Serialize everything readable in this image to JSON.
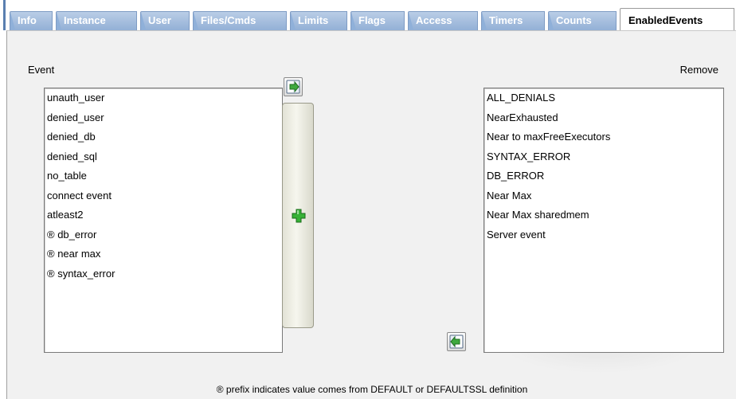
{
  "tabs": [
    {
      "label": "Info",
      "active": false
    },
    {
      "label": "Instance",
      "active": false
    },
    {
      "label": "User",
      "active": false
    },
    {
      "label": "Files/Cmds",
      "active": false
    },
    {
      "label": "Limits",
      "active": false
    },
    {
      "label": "Flags",
      "active": false
    },
    {
      "label": "Access",
      "active": false
    },
    {
      "label": "Timers",
      "active": false
    },
    {
      "label": "Counts",
      "active": false
    },
    {
      "label": "EnabledEvents",
      "active": true
    }
  ],
  "event_label": "Event",
  "remove_label": "Remove",
  "event_list": [
    "unauth_user",
    "denied_user",
    "denied_db",
    "denied_sql",
    "no_table",
    "connect event",
    "atleast2",
    "® db_error",
    "® near max",
    "® syntax_error"
  ],
  "remove_list": [
    "ALL_DENIALS",
    "NearExhausted",
    "Near to maxFreeExecutors",
    "SYNTAX_ERROR",
    "DB_ERROR",
    "Near Max",
    "Near Max sharedmem",
    "Server event"
  ],
  "footer_note": "® prefix indicates value comes from DEFAULT or DEFAULTSSL definition",
  "icons": {
    "move_right": "arrow-right-icon",
    "move_left": "arrow-left-icon",
    "add": "plus-icon"
  },
  "colors": {
    "tab_inactive": "#a7c0e2",
    "tab_border": "#7f9cc4",
    "panel_bg": "#f1f1f1",
    "plus_green": "#2ea82e"
  }
}
